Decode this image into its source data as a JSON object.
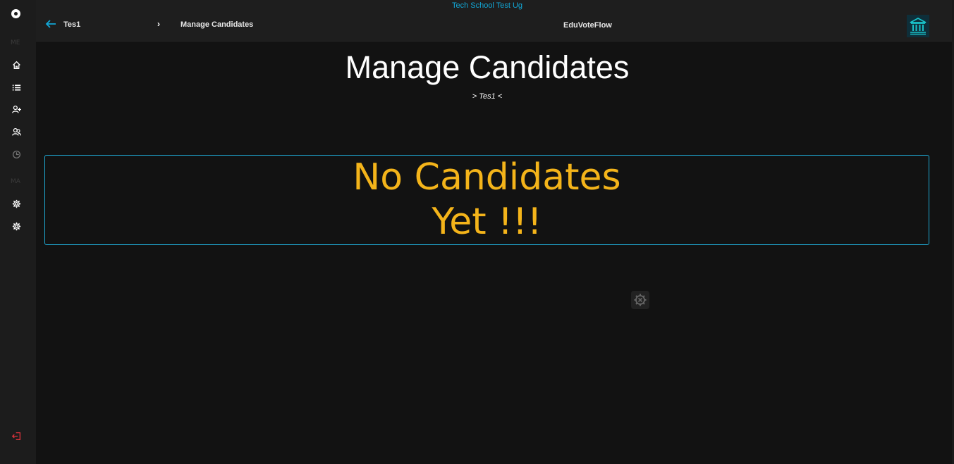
{
  "sidebar": {
    "section_1": "ME",
    "section_2": "MA",
    "items": [
      {
        "icon": "home-icon"
      },
      {
        "icon": "list-icon"
      },
      {
        "icon": "add-user-icon"
      },
      {
        "icon": "users-icon"
      },
      {
        "icon": "clock-icon"
      },
      {
        "icon": "gear-icon"
      },
      {
        "icon": "gear-icon"
      },
      {
        "icon": "logout-icon"
      }
    ]
  },
  "header": {
    "school_name": "Tech School Test Ug",
    "breadcrumb_1": "Tes1",
    "breadcrumb_sep": "›",
    "breadcrumb_2": "Manage Candidates",
    "app_name": "EduVoteFlow"
  },
  "main": {
    "title": "Manage Candidates",
    "subtitle": "> Tes1 <",
    "empty_message": "No Candidates Yet !!!"
  },
  "colors": {
    "accent": "#12a7d6",
    "warning": "#f4b41a",
    "logout": "#e0333c"
  }
}
